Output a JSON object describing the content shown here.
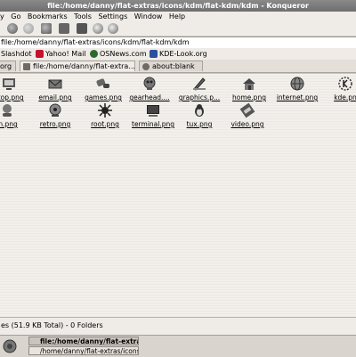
{
  "window": {
    "title": "file:/home/danny/flat-extras/icons/kdm/flat-kdm/kdm - Konqueror"
  },
  "menu": [
    "y",
    "Go",
    "Bookmarks",
    "Tools",
    "Settings",
    "Window",
    "Help"
  ],
  "location": {
    "value": "file:/home/danny/flat-extras/icons/kdm/flat-kdm/kdm"
  },
  "bookmarks": [
    {
      "label": "Slashdot",
      "icon": "slashdot-icon"
    },
    {
      "label": "Yahoo! Mail",
      "icon": "yahoo-icon"
    },
    {
      "label": "OSNews.com",
      "icon": "osnews-icon"
    },
    {
      "label": "KDE-Look.org",
      "icon": "kdelook-icon"
    }
  ],
  "tabs": [
    {
      "label": "org"
    },
    {
      "label": "file:/home/danny/flat-extra..."
    },
    {
      "label": "about:blank"
    }
  ],
  "files_row1": [
    {
      "name": "ktop.png",
      "icon": "desktop-icon"
    },
    {
      "name": "email.png",
      "icon": "email-icon"
    },
    {
      "name": "games.png",
      "icon": "gamepad-icon"
    },
    {
      "name": "gearhead....",
      "icon": "gearhead-icon"
    },
    {
      "name": "graphics.p...",
      "icon": "graphics-icon"
    },
    {
      "name": "home.png",
      "icon": "home-icon"
    },
    {
      "name": "internet.png",
      "icon": "internet-icon"
    },
    {
      "name": "kde.pn",
      "icon": "kde-icon"
    }
  ],
  "files_row2": [
    {
      "name": "in.png",
      "icon": "user-icon"
    },
    {
      "name": "retro.png",
      "icon": "retro-icon"
    },
    {
      "name": "root.png",
      "icon": "root-icon"
    },
    {
      "name": "terminal.png",
      "icon": "terminal-icon"
    },
    {
      "name": "tux.png",
      "icon": "tux-icon"
    },
    {
      "name": "video.png",
      "icon": "video-icon"
    }
  ],
  "status": {
    "text": "es (51.9 KB Total) - 0 Folders"
  },
  "taskbar": [
    {
      "label": "file:/home/danny/flat-extras",
      "active": true
    },
    {
      "label": "/home/danny/flat-extras/icons",
      "active": false
    }
  ]
}
